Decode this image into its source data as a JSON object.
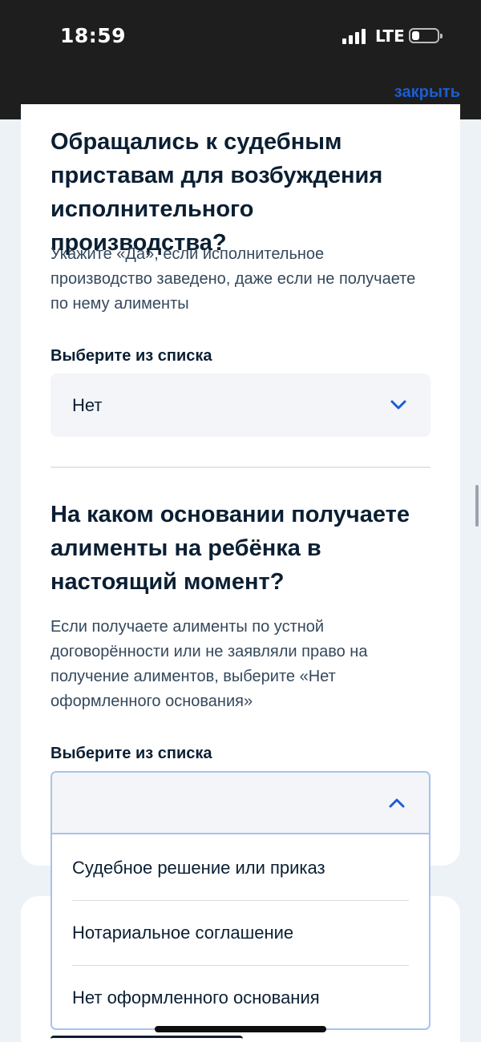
{
  "status_bar": {
    "time": "18:59",
    "network": "LTE",
    "icons": [
      "signal-icon",
      "battery-icon"
    ]
  },
  "header": {
    "close_label": "закрыть",
    "accent_color": "#1c5dd1"
  },
  "question1": {
    "title": "Обращались к судебным приставам для возбуждения исполнительного производства?",
    "hint": "Укажите «Да», если исполнительное производство заведено, даже если не получаете по нему алименты",
    "select_label": "Выберите из списка",
    "selected_value": "Нет"
  },
  "question2": {
    "title": "На каком основании получаете алименты на ребёнка в настоящий момент?",
    "hint": "Если получаете алименты по устной договорённости или не заявляли право на получение алиментов, выберите «Нет оформленного основания»",
    "select_label": "Выберите из списка",
    "selected_value": "",
    "options": [
      "Судебное решение или приказ",
      "Нотариальное соглашение",
      "Нет оформленного основания"
    ]
  }
}
